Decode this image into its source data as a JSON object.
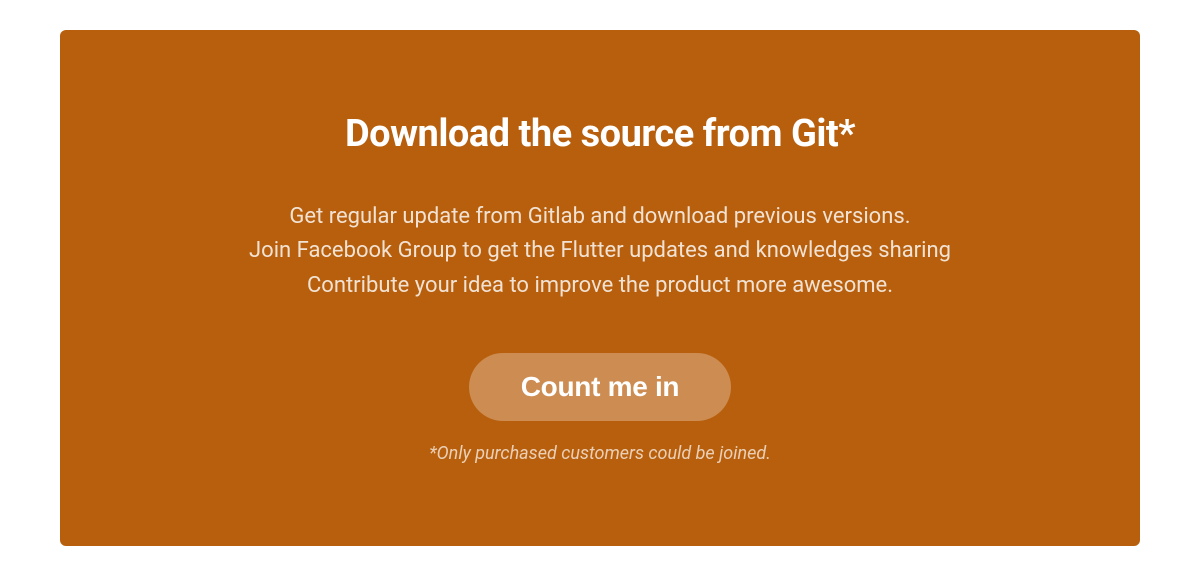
{
  "card": {
    "headline": "Download the source from Git*",
    "description_line1": "Get regular update from Gitlab and download previous versions.",
    "description_line2": "Join Facebook Group to get the Flutter updates and knowledges sharing",
    "description_line3": "Contribute your idea to improve the product more awesome.",
    "cta_label": "Count me in",
    "footnote": "*Only purchased customers could be joined."
  },
  "colors": {
    "card_bg": "#b75f0c",
    "button_bg": "#cd8c52",
    "text_primary": "#ffffff"
  }
}
